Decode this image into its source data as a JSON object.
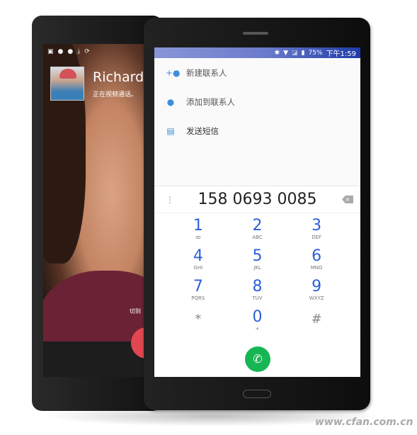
{
  "back_device": {
    "status_icons": [
      "image-icon",
      "wechat-icon",
      "wechat-icon",
      "download-icon",
      "sync-icon"
    ],
    "caller_name": "Richards",
    "caller_status": "正在视频通话。",
    "switch_label": "切到",
    "end_call_color": "#e0474f"
  },
  "front_device": {
    "status": {
      "battery": "75%",
      "time": "下午1:59",
      "bar_color": "#6a7acb"
    },
    "menu": [
      {
        "icon": "add-person-icon",
        "label": "新建联系人"
      },
      {
        "icon": "person-icon",
        "label": "添加到联系人"
      },
      {
        "icon": "message-icon",
        "label": "发送短信"
      }
    ],
    "dialpad": {
      "number": "158 0693 0085",
      "keys": [
        {
          "digit": "1",
          "letters": "ꝏ"
        },
        {
          "digit": "2",
          "letters": "ABC"
        },
        {
          "digit": "3",
          "letters": "DEF"
        },
        {
          "digit": "4",
          "letters": "GHI"
        },
        {
          "digit": "5",
          "letters": "JKL"
        },
        {
          "digit": "6",
          "letters": "MNO"
        },
        {
          "digit": "7",
          "letters": "PQRS"
        },
        {
          "digit": "8",
          "letters": "TUV"
        },
        {
          "digit": "9",
          "letters": "WXYZ"
        },
        {
          "digit": "*",
          "letters": ""
        },
        {
          "digit": "0",
          "letters": "+"
        },
        {
          "digit": "#",
          "letters": ""
        }
      ],
      "digit_color": "#2e5fd8",
      "call_color": "#17b655"
    }
  },
  "watermark": "www.cfan.com.cn"
}
